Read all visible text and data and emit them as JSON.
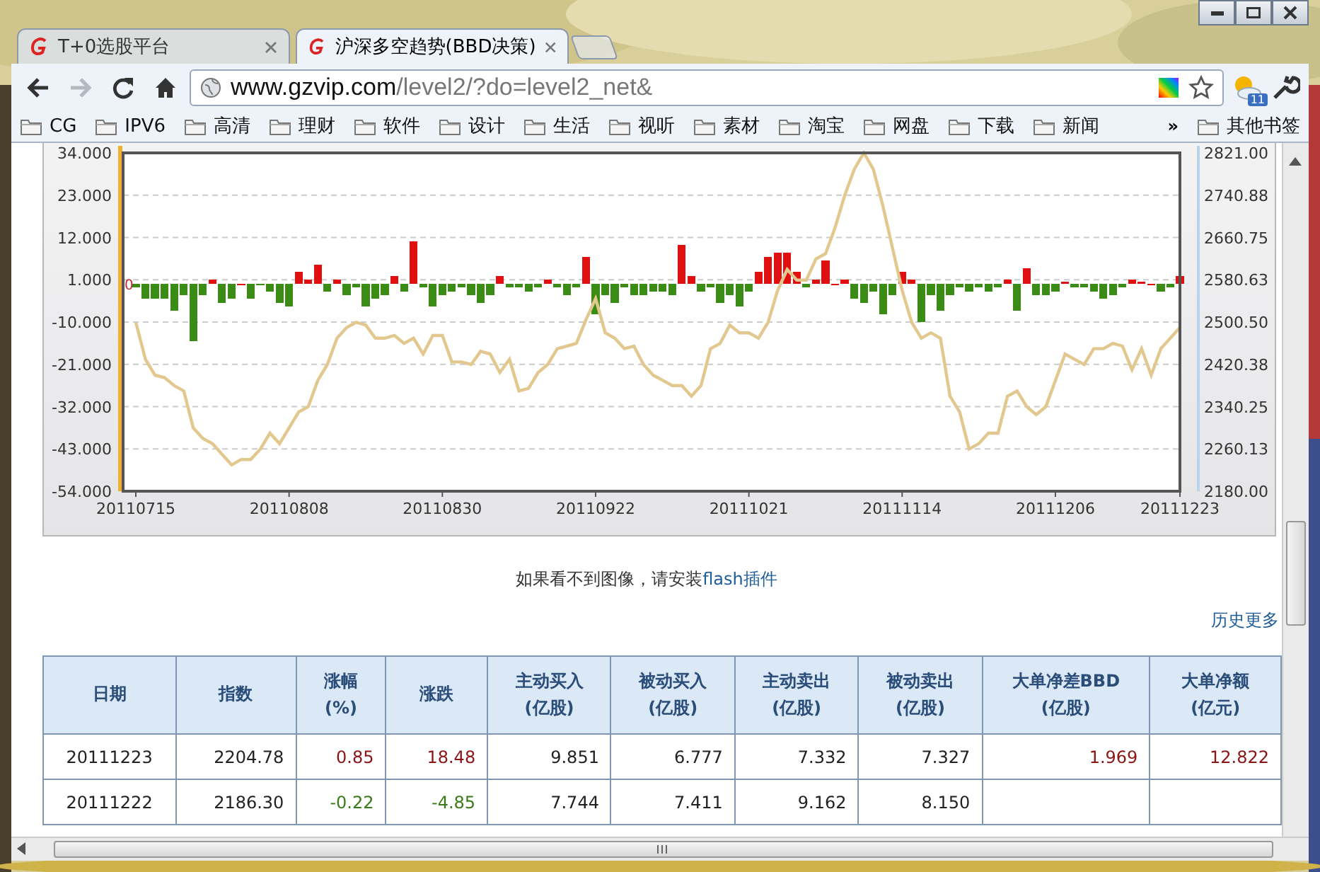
{
  "tabs": [
    {
      "label": "T+0选股平台",
      "selected": false
    },
    {
      "label": "沪深多空趋势(BBD决策)",
      "selected": true
    }
  ],
  "toolbar": {
    "nav": [
      {
        "kind": "back",
        "disabled": false
      },
      {
        "kind": "forward",
        "disabled": true
      },
      {
        "kind": "reload",
        "disabled": false
      },
      {
        "kind": "home",
        "disabled": false
      }
    ],
    "address": {
      "host": "www.gzvip.com",
      "path": "/level2/?do=level2_net&"
    },
    "weather_badge": "11"
  },
  "bookmarks": {
    "items": [
      "CG",
      "IPV6",
      "高清",
      "理财",
      "软件",
      "设计",
      "生活",
      "视听",
      "素材",
      "淘宝",
      "网盘",
      "下载",
      "新闻"
    ],
    "overflow": "»",
    "other": "其他书签"
  },
  "chart": {
    "chart_data": {
      "type": "bar",
      "categories": [
        "20110715",
        null,
        null,
        null,
        null,
        null,
        null,
        null,
        null,
        null,
        null,
        null,
        null,
        null,
        null,
        null,
        "20110808",
        null,
        null,
        null,
        null,
        null,
        null,
        null,
        null,
        null,
        null,
        null,
        null,
        null,
        null,
        null,
        "20110830",
        null,
        null,
        null,
        null,
        null,
        null,
        null,
        null,
        null,
        null,
        null,
        null,
        null,
        null,
        null,
        "20110922",
        null,
        null,
        null,
        null,
        null,
        null,
        null,
        null,
        null,
        null,
        null,
        null,
        null,
        null,
        null,
        "20111021",
        null,
        null,
        null,
        null,
        null,
        null,
        null,
        null,
        null,
        null,
        null,
        null,
        null,
        null,
        null,
        "20111114",
        null,
        null,
        null,
        null,
        null,
        null,
        null,
        null,
        null,
        null,
        null,
        null,
        null,
        null,
        null,
        "20111206",
        null,
        null,
        null,
        null,
        null,
        null,
        null,
        null,
        null,
        null,
        null,
        null,
        "20111223"
      ],
      "ylim": [
        -54,
        34
      ],
      "yticks": [
        {
          "value": -54,
          "label": "-54.000"
        },
        {
          "value": -43,
          "label": "-43.000"
        },
        {
          "value": -32,
          "label": "-32.000"
        },
        {
          "value": -21,
          "label": "-21.000"
        },
        {
          "value": -10,
          "label": "-10.000"
        },
        {
          "value": 1,
          "label": "1.000"
        },
        {
          "value": 12,
          "label": "12.000"
        },
        {
          "value": 23,
          "label": "23.000"
        },
        {
          "value": 34,
          "label": "34.000"
        }
      ],
      "y2lim": [
        2180,
        2821
      ],
      "y2ticks": [
        {
          "value": 2180,
          "label": "2180.00"
        },
        {
          "value": 2260.13,
          "label": "2260.13"
        },
        {
          "value": 2340.25,
          "label": "2340.25"
        },
        {
          "value": 2420.38,
          "label": "2420.38"
        },
        {
          "value": 2500.5,
          "label": "2500.50"
        },
        {
          "value": 2580.63,
          "label": "2580.63"
        },
        {
          "value": 2660.75,
          "label": "2660.75"
        },
        {
          "value": 2740.88,
          "label": "2740.88"
        },
        {
          "value": 2821,
          "label": "2821.00"
        }
      ],
      "annotations": [
        "0"
      ],
      "grid": true,
      "series": [
        {
          "colors": [
            "#3a8c14",
            "#3a8c14",
            "#3a8c14",
            "#3a8c14",
            "#3a8c14",
            "#3a8c14",
            "#3a8c14",
            "#3a8c14",
            "#e01010",
            "#3a8c14",
            "#3a8c14",
            "#e01010",
            "#3a8c14",
            "#3a8c14",
            "#3a8c14",
            "#3a8c14",
            "#3a8c14",
            "#e01010",
            "#e01010",
            "#e01010",
            "#3a8c14",
            "#e01010",
            "#3a8c14",
            "#3a8c14",
            "#3a8c14",
            "#3a8c14",
            "#3a8c14",
            "#e01010",
            "#3a8c14",
            "#e01010",
            "#3a8c14",
            "#3a8c14",
            "#3a8c14",
            "#3a8c14",
            "#3a8c14",
            "#3a8c14",
            "#3a8c14",
            "#3a8c14",
            "#e01010",
            "#3a8c14",
            "#3a8c14",
            "#3a8c14",
            "#3a8c14",
            "#e01010",
            "#3a8c14",
            "#3a8c14",
            "#3a8c14",
            "#e01010",
            "#3a8c14",
            "#3a8c14",
            "#3a8c14",
            "#3a8c14",
            "#3a8c14",
            "#3a8c14",
            "#3a8c14",
            "#3a8c14",
            "#3a8c14",
            "#e01010",
            "#e01010",
            "#3a8c14",
            "#3a8c14",
            "#3a8c14",
            "#3a8c14",
            "#3a8c14",
            "#3a8c14",
            "#e01010",
            "#e01010",
            "#e01010",
            "#e01010",
            "#e01010",
            "#3a8c14",
            "#e01010",
            "#e01010",
            "#e01010",
            "#e01010",
            "#3a8c14",
            "#3a8c14",
            "#3a8c14",
            "#3a8c14",
            "#3a8c14",
            "#e01010",
            "#e01010",
            "#3a8c14",
            "#3a8c14",
            "#3a8c14",
            "#3a8c14",
            "#3a8c14",
            "#3a8c14",
            "#3a8c14",
            "#3a8c14",
            "#3a8c14",
            "#e01010",
            "#3a8c14",
            "#e01010",
            "#3a8c14",
            "#3a8c14",
            "#3a8c14",
            "#e01010",
            "#3a8c14",
            "#3a8c14",
            "#3a8c14",
            "#3a8c14",
            "#3a8c14",
            "#3a8c14",
            "#e01010",
            "#e01010",
            "#e01010",
            "#3a8c14",
            "#3a8c14",
            "#e01010"
          ],
          "values": [
            -1,
            -4,
            -4,
            -4,
            -7,
            -3,
            -15,
            -3,
            1,
            -5,
            -4,
            0,
            -4,
            -0.5,
            -2,
            -5,
            -6,
            3,
            1,
            5,
            -2,
            1,
            -3,
            -1,
            -6,
            -4,
            -3,
            2,
            -2,
            11,
            -1,
            -6,
            -3,
            -2,
            -1,
            -3,
            -5,
            -3,
            2,
            -1,
            -1,
            -2,
            -1,
            1,
            -1,
            -3,
            -1,
            7,
            -8,
            -3,
            -5,
            -1,
            -3,
            -3,
            -2,
            -2,
            -3,
            10,
            2,
            -2,
            -1,
            -5,
            -3,
            -6,
            -2,
            3,
            7,
            8,
            8,
            3,
            -1,
            1,
            6,
            0,
            1,
            -4,
            -5,
            -2,
            -8,
            -3,
            3,
            1,
            -10,
            -3,
            -7,
            -3,
            -1,
            -2,
            -1,
            -2,
            -1,
            1,
            -7,
            4,
            -3,
            -3,
            -2,
            0.5,
            -1,
            -1,
            -2,
            -4,
            -3,
            -1,
            1,
            0.5,
            0,
            -2,
            -1,
            2
          ]
        },
        {
          "type": "line",
          "axis": "y2",
          "color": "#e2c88e",
          "values": [
            2500,
            2430,
            2400,
            2395,
            2380,
            2370,
            2300,
            2280,
            2270,
            2250,
            2230,
            2240,
            2240,
            2260,
            2290,
            2270,
            2300,
            2330,
            2340,
            2390,
            2420,
            2470,
            2490,
            2500,
            2495,
            2470,
            2470,
            2475,
            2460,
            2470,
            2440,
            2475,
            2475,
            2425,
            2425,
            2420,
            2445,
            2440,
            2405,
            2430,
            2370,
            2375,
            2405,
            2420,
            2450,
            2455,
            2460,
            2505,
            2545,
            2480,
            2470,
            2450,
            2455,
            2420,
            2400,
            2390,
            2380,
            2380,
            2360,
            2380,
            2450,
            2460,
            2495,
            2480,
            2480,
            2470,
            2500,
            2560,
            2600,
            2580,
            2580,
            2620,
            2630,
            2680,
            2740,
            2790,
            2821,
            2790,
            2720,
            2640,
            2560,
            2500,
            2470,
            2480,
            2470,
            2360,
            2330,
            2260,
            2270,
            2290,
            2290,
            2360,
            2370,
            2340,
            2325,
            2340,
            2390,
            2440,
            2430,
            2420,
            2450,
            2450,
            2460,
            2455,
            2410,
            2450,
            2400,
            2450,
            2470,
            2490
          ]
        }
      ]
    }
  },
  "notice": {
    "text": "如果看不到图像，请安装",
    "link": "flash插件"
  },
  "more_link": "历史更多",
  "table": {
    "columns": [
      {
        "label": "日期"
      },
      {
        "label": "指数"
      },
      {
        "label": "涨幅",
        "unit": "(%)"
      },
      {
        "label": "涨跌"
      },
      {
        "label": "主动买入",
        "unit": "(亿股)"
      },
      {
        "label": "被动买入",
        "unit": "(亿股)"
      },
      {
        "label": "主动卖出",
        "unit": "(亿股)"
      },
      {
        "label": "被动卖出",
        "unit": "(亿股)"
      },
      {
        "label": "大单净差BBD",
        "unit": "(亿股)"
      },
      {
        "label": "大单净额",
        "unit": "(亿元)"
      }
    ],
    "rows": [
      [
        {
          "text": "20111223"
        },
        {
          "text": "2204.78"
        },
        {
          "text": "0.85",
          "color": "#8b1515"
        },
        {
          "text": "18.48",
          "color": "#8b1515"
        },
        {
          "text": "9.851"
        },
        {
          "text": "6.777"
        },
        {
          "text": "7.332"
        },
        {
          "text": "7.327"
        },
        {
          "text": "1.969",
          "color": "#8b1515"
        },
        {
          "text": "12.822",
          "color": "#8b1515"
        }
      ],
      [
        {
          "text": "20111222"
        },
        {
          "text": "2186.30"
        },
        {
          "text": "-0.22",
          "color": "#3a7a18"
        },
        {
          "text": "-4.85",
          "color": "#3a7a18"
        },
        {
          "text": "7.744"
        },
        {
          "text": "7.411"
        },
        {
          "text": "9.162"
        },
        {
          "text": "8.150"
        }
      ]
    ]
  }
}
